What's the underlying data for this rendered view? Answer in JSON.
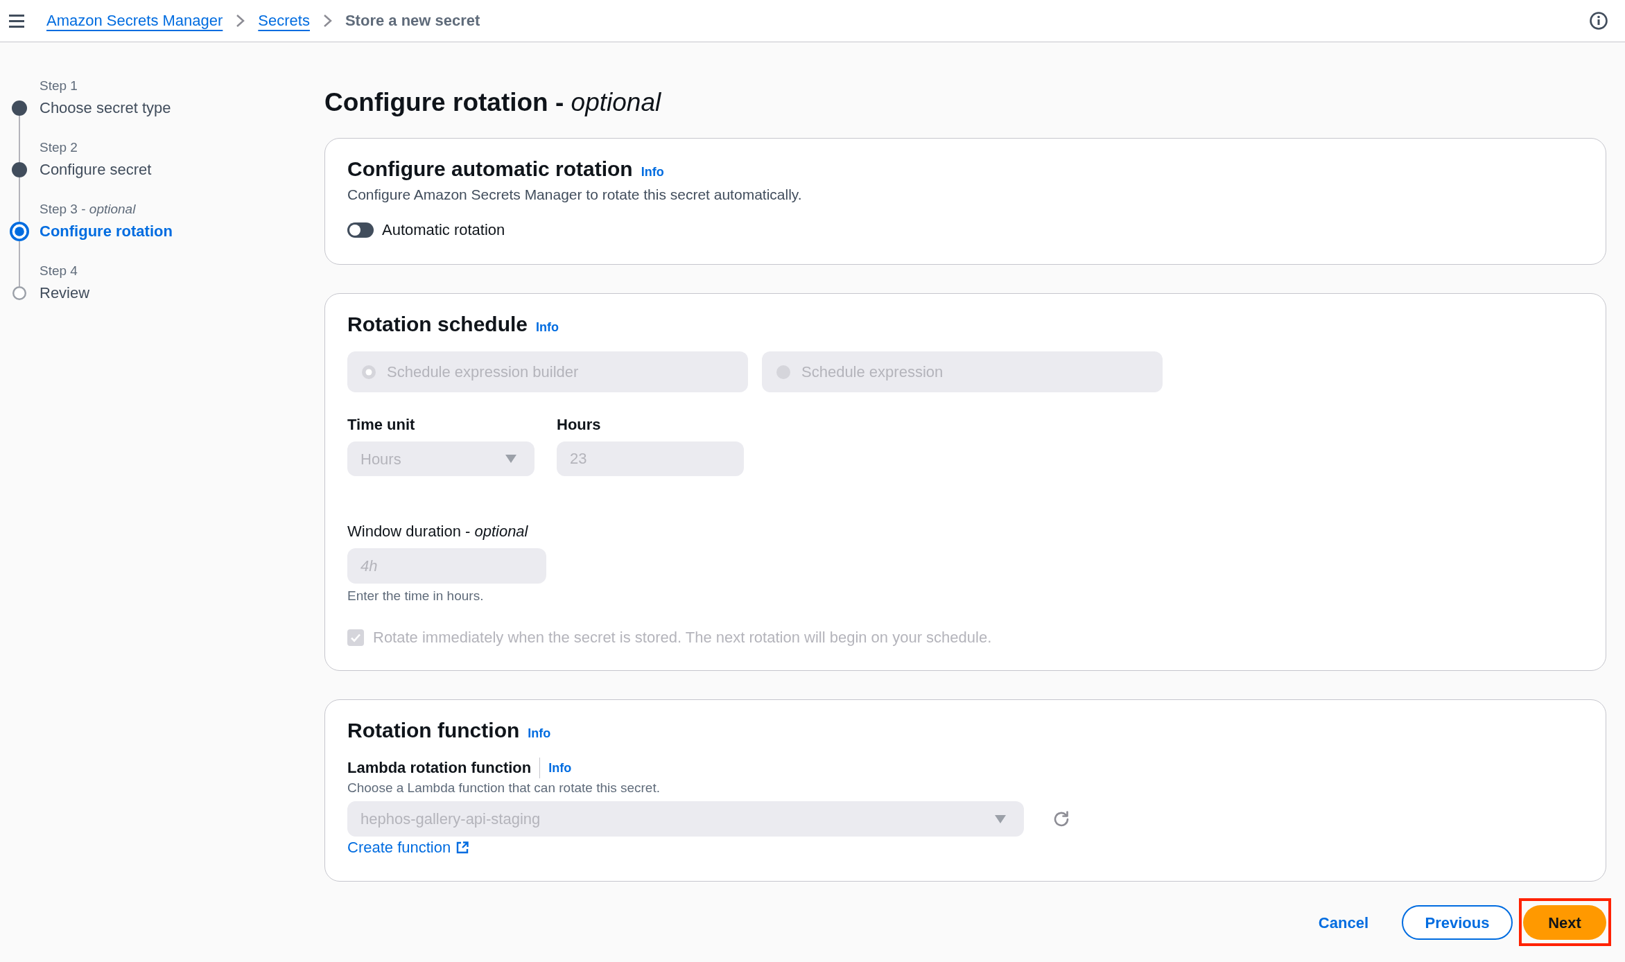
{
  "top_bar": {
    "breadcrumbs": [
      {
        "label": "Amazon Secrets Manager",
        "kind": "link"
      },
      {
        "label": "Secrets",
        "kind": "link"
      },
      {
        "label": "Store a new secret",
        "kind": "current"
      }
    ]
  },
  "steps": [
    {
      "label": "Step 1",
      "title": "Choose secret type",
      "completed": true,
      "selected": false
    },
    {
      "label": "Step 2",
      "title": "Configure secret",
      "completed": true,
      "selected": false
    },
    {
      "label": "Step 3 - *optional*",
      "title": "Configure rotation",
      "completed": false,
      "selected": true
    },
    {
      "label": "Step 4",
      "title": "Review",
      "completed": false,
      "selected": false
    }
  ],
  "page_title": "Configure rotation - *optional*",
  "automatic_rotation": {
    "heading": "Configure automatic rotation",
    "info": "Info",
    "description": "Configure Amazon Secrets Manager to rotate this secret automatically.",
    "toggle": {
      "label": "Automatic rotation",
      "on": false
    }
  },
  "rotation_schedule": {
    "heading": "Rotation schedule",
    "info": "Info",
    "disabled": true,
    "modes": [
      {
        "label": "Schedule expression builder",
        "selected": true
      },
      {
        "label": "Schedule expression",
        "selected": false
      }
    ],
    "time_unit": {
      "label": "Time unit",
      "value": "Hours"
    },
    "hours": {
      "label": "Hours",
      "value": "23"
    },
    "window_duration": {
      "label": "Window duration - *optional*",
      "placeholder": "4h",
      "hint": "Enter the time in hours."
    },
    "rotate_immediately": {
      "label": "Rotate immediately when the secret is stored. The next rotation will begin on your schedule.",
      "checked": true
    }
  },
  "rotation_function": {
    "heading": "Rotation function",
    "info": "Info",
    "lambda": {
      "label": "Lambda rotation function",
      "info": "Info",
      "description": "Choose a Lambda function that can rotate this secret.",
      "value": "hephos-gallery-api-staging",
      "disabled": true
    },
    "create_link": "Create function"
  },
  "footer_buttons": [
    {
      "label": "Cancel",
      "kind": "link",
      "highlighted": false
    },
    {
      "label": "Previous",
      "kind": "secondary",
      "highlighted": false
    },
    {
      "label": "Next",
      "kind": "primary",
      "highlighted": true
    }
  ]
}
